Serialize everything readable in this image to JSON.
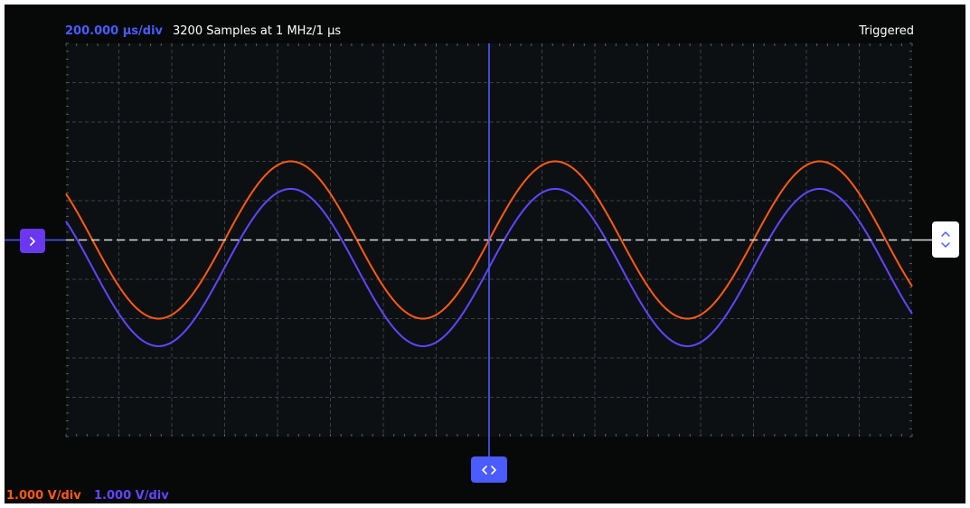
{
  "header": {
    "timebase": "200.000 µs/div",
    "samples": "3200 Samples at 1 MHz/1 µs",
    "status": "Triggered"
  },
  "channels": [
    {
      "scale": "1.000 V/div",
      "color": "#ff5a14"
    },
    {
      "scale": "1.000 V/div",
      "color": "#6444ff"
    }
  ],
  "colors": {
    "background": "#070808",
    "plot_background": "#0d1013",
    "grid": "#3a3f44",
    "cursor": "#4a5cff",
    "trigger_line": "#d8d8d8",
    "accent": "#4a5cff",
    "trigger_button": "#6a38f0"
  },
  "icons": {
    "trigger": "chevron-right-icon",
    "horizontal": "chevron-left-right-icon",
    "vertical": "chevron-up-down-icon"
  },
  "chart_data": {
    "type": "line",
    "x_unit": "µs",
    "y_unit": "V",
    "xlim": [
      0,
      3200
    ],
    "ylim": [
      -5,
      5
    ],
    "x_divisions": 16,
    "y_divisions": 10,
    "grid": true,
    "trigger_level": 0,
    "trigger_time": 1600,
    "series": [
      {
        "channel": 1,
        "color": "#ff5a14",
        "waveform": "sine",
        "amplitude_v": 2.0,
        "offset_v": 0,
        "period_us": 1000,
        "zero_crossing_rising_us": 1600
      },
      {
        "channel": 2,
        "color": "#6444ff",
        "waveform": "sine",
        "amplitude_v": 2.0,
        "offset_v": -0.7,
        "period_us": 1000,
        "zero_crossing_rising_us": 1600
      }
    ]
  }
}
